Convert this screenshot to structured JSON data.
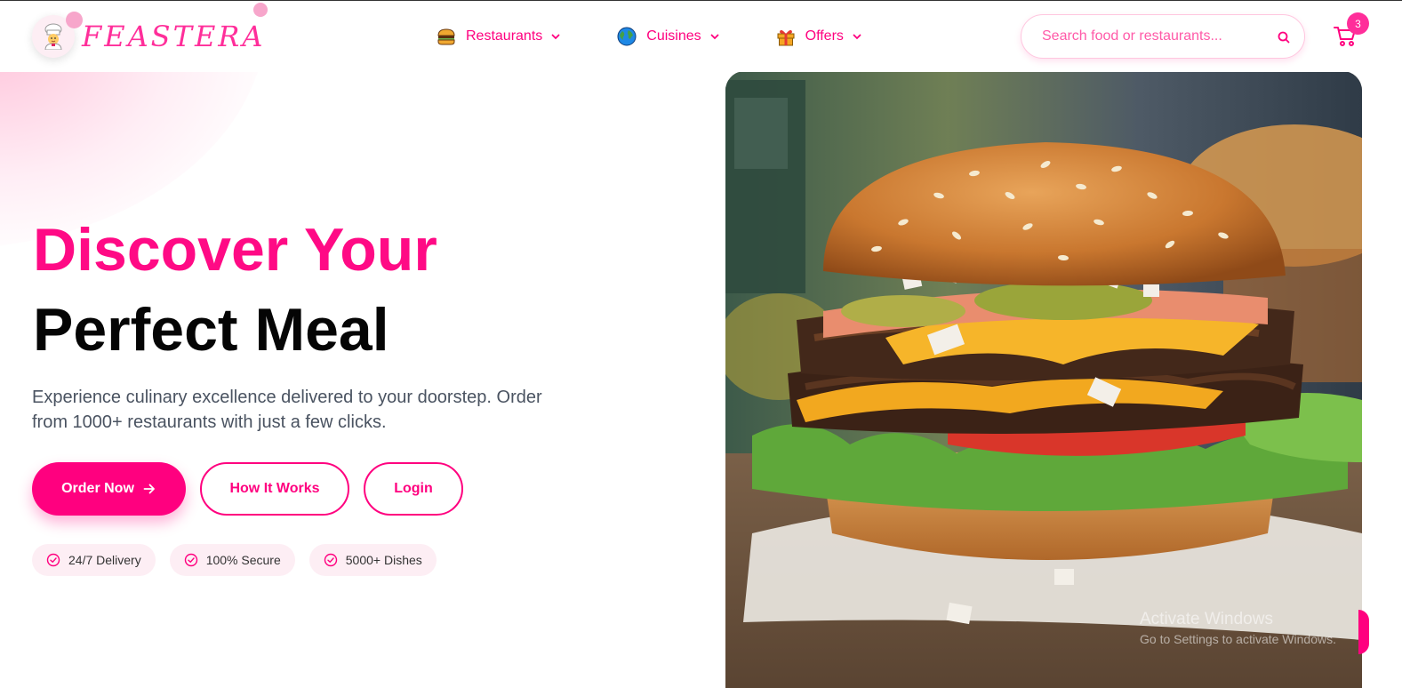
{
  "brand": {
    "name": "FEASTERA",
    "logo_icon": "chef-emoji-icon"
  },
  "nav": {
    "items": [
      {
        "label": "Restaurants",
        "icon": "burger-icon"
      },
      {
        "label": "Cuisines",
        "icon": "globe-icon"
      },
      {
        "label": "Offers",
        "icon": "gift-icon"
      }
    ]
  },
  "search": {
    "placeholder": "Search food or restaurants...",
    "value": ""
  },
  "cart": {
    "count": "3"
  },
  "hero": {
    "title_line1": "Discover Your",
    "title_line2": "Perfect Meal",
    "subtitle": "Experience culinary excellence delivered to your doorstep. Order from 1000+ restaurants with just a few clicks.",
    "buttons": {
      "order": "Order Now",
      "how": "How It Works",
      "login": "Login"
    },
    "features": [
      "24/7 Delivery",
      "100% Secure",
      "5000+ Dishes"
    ]
  },
  "watermark": {
    "line1": "Activate Windows",
    "line2": "Go to Settings to activate Windows."
  },
  "colors": {
    "accent": "#ff007f",
    "accent_light": "#fdeef4",
    "text_dark": "#050505",
    "text_muted": "#4a5361"
  }
}
